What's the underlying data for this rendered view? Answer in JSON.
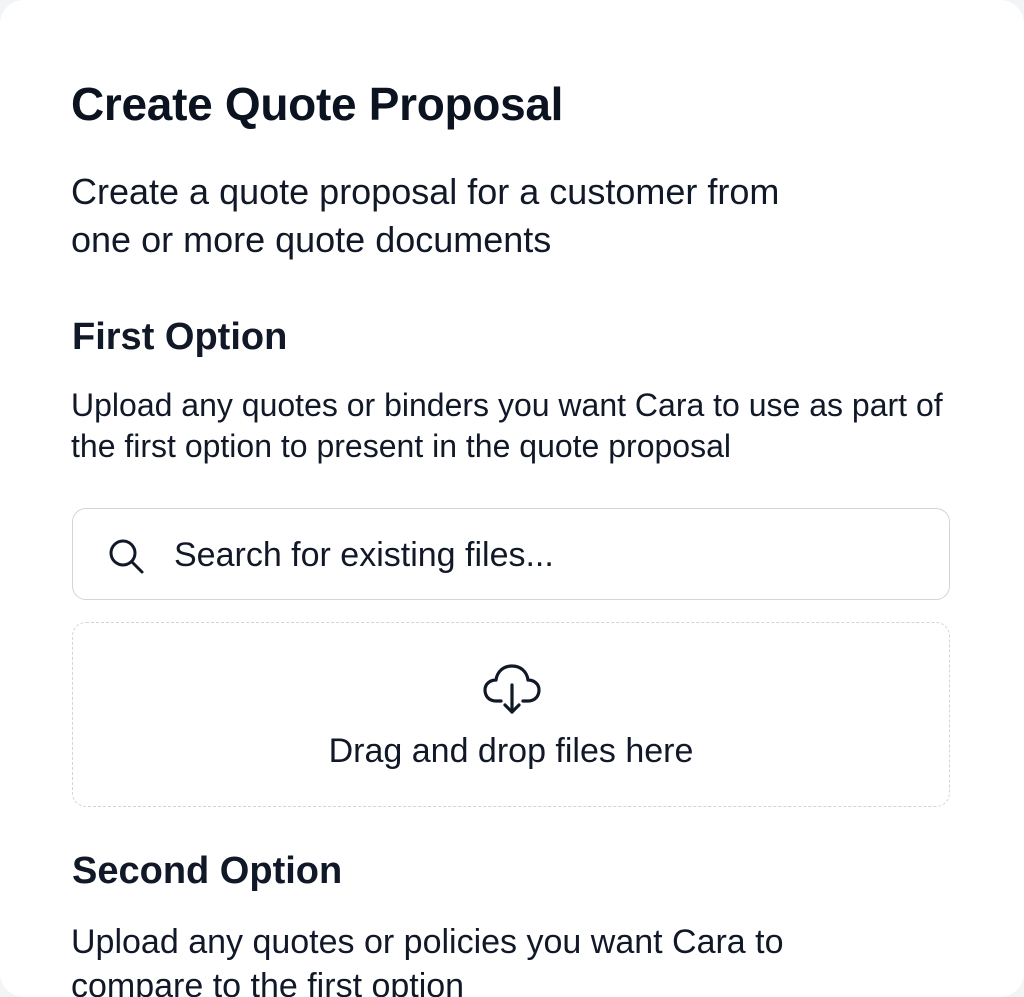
{
  "dialog": {
    "title": "Create Quote Proposal",
    "subtitle": "Create a quote proposal for a customer from one or more quote documents"
  },
  "first_option": {
    "heading": "First Option",
    "description": "Upload any quotes or binders you want Cara to use as part of the first option to present in the quote proposal",
    "search": {
      "icon": "search-icon",
      "placeholder": "Search for existing files...",
      "value": ""
    },
    "dropzone": {
      "icon": "cloud-download-icon",
      "label": "Drag and drop files here"
    }
  },
  "second_option": {
    "heading": "Second Option",
    "description": "Upload any quotes or policies you want Cara to compare to the first option"
  },
  "colors": {
    "background": "#ffffff",
    "text": "#111827",
    "border": "#d1d5db"
  }
}
